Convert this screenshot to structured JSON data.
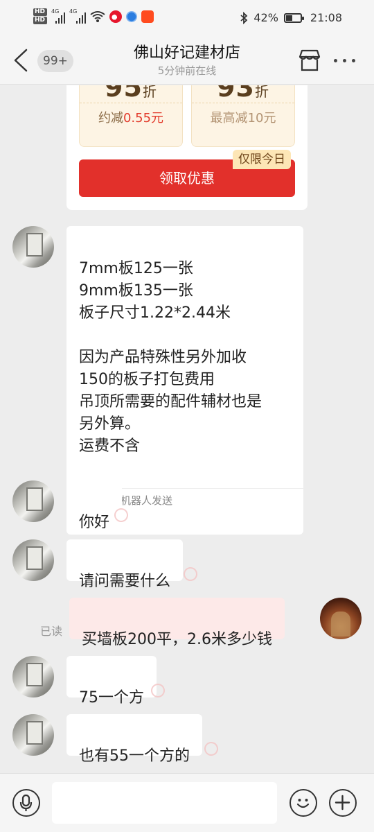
{
  "status_bar": {
    "hd1": "HD",
    "hd2": "HD",
    "net1": "4G",
    "net2": "4G",
    "battery_percent": "42%",
    "battery_level": 0.42,
    "time": "21:08"
  },
  "nav": {
    "unread_badge": "99+",
    "title": "佛山好记建材店",
    "subtitle": "5分钟前在线"
  },
  "coupon_card": {
    "coupons": [
      {
        "discount": "95",
        "unit": "折",
        "desc_prefix": "约减",
        "desc_value": "0.55元"
      },
      {
        "discount": "93",
        "unit": "折",
        "desc_prefix": "最高减10元",
        "desc_value": ""
      }
    ],
    "claim_button": "领取优惠",
    "tag": "仅限今日"
  },
  "messages": [
    {
      "from": "shop",
      "text": "7mm板125一张\n9mm板135一张\n板子尺寸1.22*2.44米\n\n因为产品特殊性另外加收\n150的板子打包费用\n吊顶所需要的配件辅材也是\n另外算。\n运费不含",
      "footer": "此消息由机器人发送"
    },
    {
      "from": "shop",
      "text": "你好"
    },
    {
      "from": "shop",
      "text": "请问需要什么"
    },
    {
      "from": "me",
      "text": "买墙板200平，2.6米多少钱",
      "status": "已读"
    },
    {
      "from": "shop",
      "text": "75一个方"
    },
    {
      "from": "shop",
      "text": "也有55一个方的"
    }
  ],
  "input": {
    "placeholder": ""
  },
  "colors": {
    "accent_red": "#e2302b",
    "coupon_bg": "#fdf4e4",
    "my_bubble": "#fde9e8"
  }
}
